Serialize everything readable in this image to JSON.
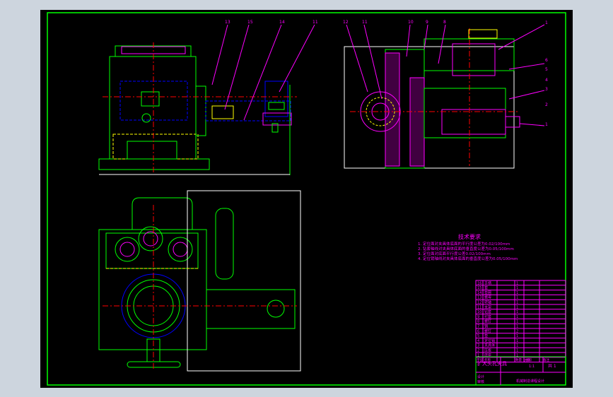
{
  "colors": {
    "background": "#000000",
    "frame": "#00ff00",
    "annotation": "#ff00ff",
    "hidden": "#ffff00",
    "center": "#ff0000",
    "outline": "#0000ff",
    "viewport": "#cdd5de"
  },
  "balloons_front": [
    "13",
    "15",
    "14",
    "11"
  ],
  "balloons_side": [
    "12",
    "11",
    "10",
    "9",
    "8",
    "1",
    "6",
    "5",
    "4",
    "3",
    "2",
    "1"
  ],
  "tech_requirements": {
    "title": "技术要求",
    "lines": [
      "1. 定位面对夹具体底面的平行度公差为0.02/100mm",
      "2. 钻套轴线对夹具体底面的垂直度公差为0.05/100mm",
      "3. 定位面对底面平行度公差0.02/100mm",
      "4. 定位销轴线对夹具体底面的垂直度公差为0.05/100mm"
    ]
  },
  "parts_table": {
    "rows": [
      {
        "no": "16",
        "name": "手柄",
        "qty": "1"
      },
      {
        "no": "15",
        "name": "套",
        "qty": "1"
      },
      {
        "no": "14",
        "name": "垫圈",
        "qty": "1"
      },
      {
        "no": "13",
        "name": "螺母",
        "qty": "1"
      },
      {
        "no": "12",
        "name": "转轴",
        "qty": "1"
      },
      {
        "no": "11",
        "name": "支架",
        "qty": "1"
      },
      {
        "no": "10",
        "name": "钻套",
        "qty": "1"
      },
      {
        "no": "9",
        "name": "衬套",
        "qty": "1"
      },
      {
        "no": "8",
        "name": "螺钉",
        "qty": "1"
      },
      {
        "no": "7",
        "name": "销",
        "qty": "1"
      },
      {
        "no": "6",
        "name": "螺钉",
        "qty": "2"
      },
      {
        "no": "5",
        "name": "垫",
        "qty": "1"
      },
      {
        "no": "4",
        "name": "定位销",
        "qty": "1"
      },
      {
        "no": "3",
        "name": "夹具体",
        "qty": "1"
      },
      {
        "no": "2",
        "name": "压板",
        "qty": "1"
      },
      {
        "no": "1",
        "name": "底座",
        "qty": "1"
      }
    ],
    "header": {
      "no": "序号",
      "name": "名称",
      "qty": "数量",
      "material": "材料",
      "note": "备注"
    }
  },
  "title_block": {
    "drawing_name": "扩大头孔夹具",
    "scale_label": "比例",
    "scale": "1:1",
    "sheet": "共 1",
    "designer": "设计",
    "checker": "审核",
    "school": "机械制造课程设计"
  }
}
